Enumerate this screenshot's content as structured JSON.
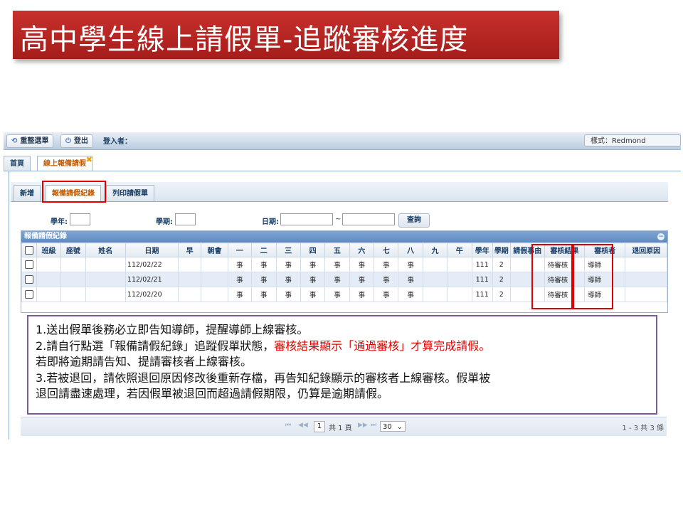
{
  "slide_title": "高中學生線上請假單-追蹤審核進度",
  "topbar": {
    "menu_button": "重整選單",
    "logout_button": "登出",
    "login_label": "登入者：",
    "style_label": "樣式：Redmond"
  },
  "main_tabs": {
    "home": "首頁",
    "leave": "線上報備請假",
    "close_glyph": "✖"
  },
  "sub_tabs": {
    "new": "新增",
    "records": "報備請假紀錄",
    "print": "列印請假單"
  },
  "filters": {
    "year_label": "學年:",
    "term_label": "學期:",
    "date_label": "日期:",
    "date_sep": "~",
    "query_button": "查詢"
  },
  "grid": {
    "title": "報備請假紀錄",
    "collapse_glyph": "−",
    "headers": [
      "",
      "班級",
      "座號",
      "姓名",
      "日期",
      "早",
      "朝會",
      "一",
      "二",
      "三",
      "四",
      "五",
      "六",
      "七",
      "八",
      "九",
      "午",
      "學年",
      "學期",
      "請假事由",
      "審核結果",
      "審核者",
      "退回原因"
    ],
    "rows": [
      [
        "",
        "",
        "",
        "",
        "112/02/22",
        "",
        "",
        "事",
        "事",
        "事",
        "事",
        "事",
        "事",
        "事",
        "事",
        "",
        "",
        "111",
        "2",
        "",
        "待審核",
        "導師",
        ""
      ],
      [
        "",
        "",
        "",
        "",
        "112/02/21",
        "",
        "",
        "事",
        "事",
        "事",
        "事",
        "事",
        "事",
        "事",
        "事",
        "",
        "",
        "111",
        "2",
        "",
        "待審核",
        "導師",
        ""
      ],
      [
        "",
        "",
        "",
        "",
        "112/02/20",
        "",
        "",
        "事",
        "事",
        "事",
        "事",
        "事",
        "事",
        "事",
        "事",
        "",
        "",
        "111",
        "2",
        "",
        "待審核",
        "導師",
        ""
      ]
    ]
  },
  "note": {
    "line1": "1.送出假單後務必立即告知導師，提醒導師上線審核。",
    "line2_black": "2.請自行點選「報備請假紀錄」追蹤假單狀態，",
    "line2_red": "審核結果顯示「通過審核」才算完成請假。",
    "line3": "若即將逾期請告知、提請審核者上線審核。",
    "line4": "3.若被退回，請依照退回原因修改後重新存檔，再告知紀錄顯示的審核者上線審核。假單被",
    "line5": "退回請盡速處理，若因假單被退回而超過請假期限，仍算是逾期請假。"
  },
  "pager": {
    "first": "⏮",
    "prev": "◀◀",
    "page": "1",
    "total_pages": "共 1 頁",
    "next": "▶▶",
    "last": "⏭",
    "page_size": "30",
    "record_count": "1 - 3 共 3 條"
  },
  "colors": {
    "banner": "#b5211f",
    "highlight": "#e00000",
    "note_border": "#7c5a95",
    "header_blue": "#6f97c9"
  }
}
